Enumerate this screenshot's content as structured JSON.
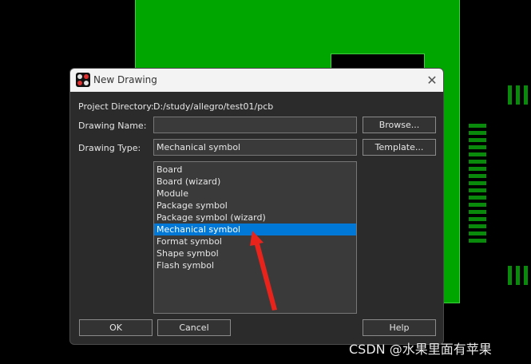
{
  "dialog": {
    "title": "New Drawing",
    "close_glyph": "✕",
    "project_directory_label": "Project Directory:",
    "project_directory_value": "D:/study/allegro/test01/pcb",
    "drawing_name_label": "Drawing Name:",
    "drawing_name_value": "",
    "drawing_type_label": "Drawing Type:",
    "drawing_type_value": "Mechanical symbol",
    "browse_label": "Browse...",
    "template_label": "Template...",
    "ok_label": "OK",
    "cancel_label": "Cancel",
    "help_label": "Help",
    "list_items": [
      "Board",
      "Board (wizard)",
      "Module",
      "Package symbol",
      "Package symbol (wizard)",
      "Mechanical symbol",
      "Format symbol",
      "Shape symbol",
      "Flash symbol"
    ],
    "selected_item": "Mechanical symbol"
  },
  "watermark": "CSDN @水果里面有苹果",
  "colors": {
    "pcb_green": "#00a600",
    "selection_blue": "#0078d7",
    "arrow_red": "#e8231c",
    "dialog_bg": "#2b2b2b"
  }
}
